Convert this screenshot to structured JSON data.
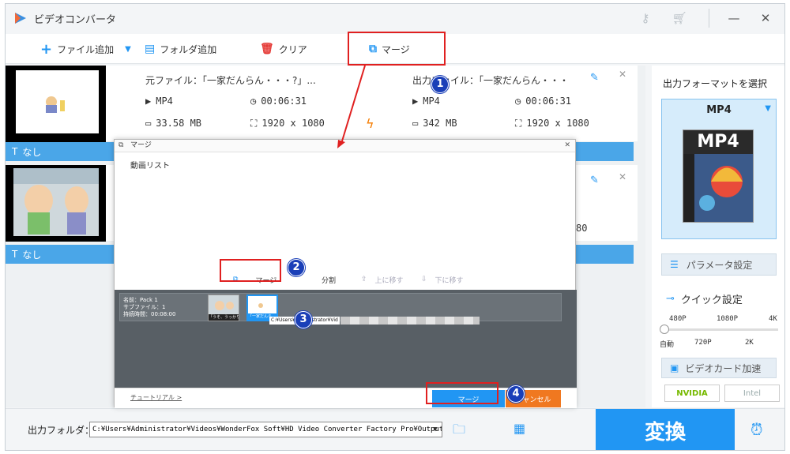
{
  "app": {
    "title": "ビデオコンバータ"
  },
  "toolbar": {
    "add_file": "ファイル追加",
    "add_folder": "フォルダ追加",
    "clear": "クリア",
    "merge": "マージ"
  },
  "items": [
    {
      "source_label": "元ファイル：「一家だんらん・・・?」...",
      "src_format": "MP4",
      "src_duration": "00:06:31",
      "src_size": "33.58 MB",
      "src_resolution": "1920 x 1080",
      "output_label": "出力ファイル：「一家だんらん・・・",
      "out_format": "MP4",
      "out_duration": "00:06:31",
      "out_size": "342 MB",
      "out_resolution": "1920 x 1080",
      "subtitle": "なし"
    },
    {
      "subtitle": "なし",
      "partial_resolution": "80"
    }
  ],
  "right_panel": {
    "format_title": "出力フォーマットを選択",
    "format_name": "MP4",
    "format_img_text": "MP4",
    "param_button": "パラメータ設定",
    "quick_label": "クイック設定",
    "quality_top": [
      "480P",
      "1080P",
      "4K"
    ],
    "quality_bottom": [
      "自動",
      "720P",
      "2K"
    ],
    "gpu_label": "ビデオカード加速",
    "nvidia": "NVIDIA",
    "intel": "Intel"
  },
  "bottom": {
    "output_folder_label": "出力フォルダ：",
    "output_path": "C:¥Users¥Administrator¥Videos¥WonderFox Soft¥HD Video Converter Factory Pro¥OutputVideo¥",
    "convert_label": "変換"
  },
  "dialog": {
    "title": "マージ",
    "list_label": "動画リスト",
    "merge_button": "マージ",
    "split_button": "分割",
    "move_up": "上に移す",
    "move_down": "下に移す",
    "pack_name": "名前：Pack 1",
    "pack_subfiles": "サブファイル：1",
    "pack_duration": "持続時間：00:08:00",
    "clip1_label": "「うそ、うっかり…",
    "clip2_label": "「一家だんら…",
    "tooltip_path": "C:¥Users¥Administrator¥Vid",
    "tutorial": "チュートリアル >",
    "merge_run": "マージ",
    "cancel": "キャンセル"
  },
  "steps": [
    "1",
    "2",
    "3",
    "4"
  ],
  "colors": {
    "accent": "#2196f3",
    "highlight": "#e02020",
    "badge": "#1a3fb8",
    "cancel": "#f07820"
  }
}
